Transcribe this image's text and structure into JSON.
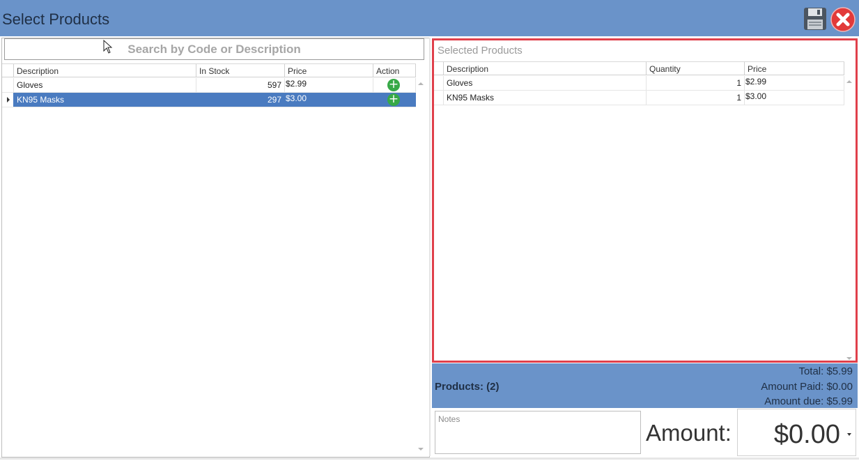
{
  "window": {
    "title": "Select Products",
    "save_icon": "floppy-disk-icon",
    "close_icon": "close-icon"
  },
  "search": {
    "placeholder": "Search by Code or Description"
  },
  "products_grid": {
    "columns": [
      "Description",
      "In Stock",
      "Price",
      "Action"
    ],
    "rows": [
      {
        "description": "Gloves",
        "in_stock": "597",
        "price": "$2.99",
        "action_icon": "add-icon"
      },
      {
        "description": "KN95 Masks",
        "in_stock": "297",
        "price": "$3.00",
        "action_icon": "add-icon",
        "selected": true
      }
    ]
  },
  "selected_products": {
    "title": "Selected Products",
    "columns": [
      "Description",
      "Quantity",
      "Price"
    ],
    "rows": [
      {
        "description": "Gloves",
        "quantity": "1",
        "price": "$2.99"
      },
      {
        "description": "KN95 Masks",
        "quantity": "1",
        "price": "$3.00"
      }
    ]
  },
  "summary": {
    "products_count": "Products: (2)",
    "total": "Total: $5.99",
    "amount_paid": "Amount Paid: $0.00",
    "amount_due": "Amount due: $5.99"
  },
  "payment": {
    "notes_placeholder": "Notes",
    "amount_label": "Amount:",
    "amount_value": "$0.00"
  },
  "colors": {
    "header": "#6a93c9",
    "selected_row": "#4a7bc0",
    "highlight_border": "#e0404b",
    "add_icon": "#37a947"
  }
}
